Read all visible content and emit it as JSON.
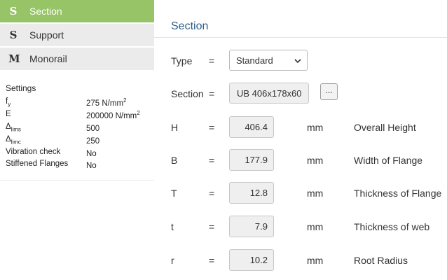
{
  "nav": {
    "items": [
      {
        "letter": "S",
        "label": "Section",
        "active": true
      },
      {
        "letter": "S",
        "label": "Support",
        "active": false
      },
      {
        "letter": "M",
        "label": "Monorail",
        "active": false
      }
    ]
  },
  "settings": {
    "title": "Settings",
    "rows": [
      {
        "key_main": "f",
        "key_sub": "y",
        "value_main": "275 N/mm",
        "value_sup": "2"
      },
      {
        "key_main": "E",
        "key_sub": "",
        "value_main": "200000 N/mm",
        "value_sup": "2"
      },
      {
        "key_main": "Δ",
        "key_sub": "lims",
        "value_main": "500",
        "value_sup": ""
      },
      {
        "key_main": "Δ",
        "key_sub": "limc",
        "value_main": "250",
        "value_sup": ""
      },
      {
        "key_main": "Vibration check",
        "key_sub": "",
        "value_main": "No",
        "value_sup": ""
      },
      {
        "key_main": "Stiffened Flanges",
        "key_sub": "",
        "value_main": "No",
        "value_sup": ""
      }
    ]
  },
  "main": {
    "title": "Section",
    "type": {
      "label": "Type",
      "eq": "=",
      "value": "Standard"
    },
    "section": {
      "label": "Section",
      "eq": "=",
      "value": "UB 406x178x60",
      "browse_label": "..."
    },
    "fields": [
      {
        "label": "H",
        "eq": "=",
        "value": "406.4",
        "unit": "mm",
        "description": "Overall Height"
      },
      {
        "label": "B",
        "eq": "=",
        "value": "177.9",
        "unit": "mm",
        "description": "Width of Flange"
      },
      {
        "label": "T",
        "eq": "=",
        "value": "12.8",
        "unit": "mm",
        "description": "Thickness of Flange"
      },
      {
        "label": "t",
        "eq": "=",
        "value": "7.9",
        "unit": "mm",
        "description": "Thickness of web"
      },
      {
        "label": "r",
        "eq": "=",
        "value": "10.2",
        "unit": "mm",
        "description": "Root Radius"
      }
    ]
  },
  "colors": {
    "accent_green": "#96c466",
    "nav_gray": "#ebebeb",
    "title_blue": "#2e5e8a",
    "readonly_bg": "#efefef"
  },
  "icons": {
    "select_chevron": "chevron-down-icon"
  }
}
